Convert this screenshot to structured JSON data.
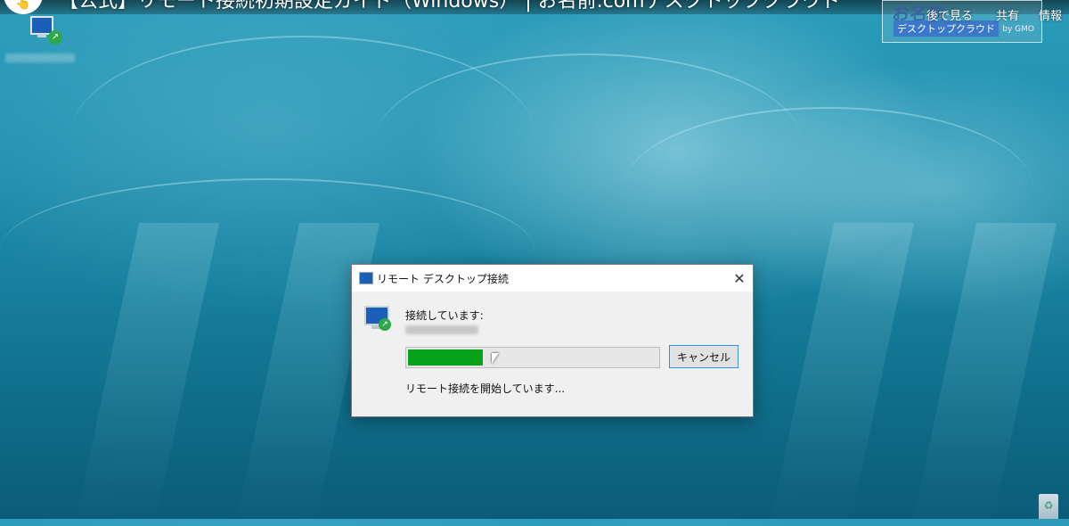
{
  "video": {
    "title": "【公式】リモート接続初期設定ガイド（Windows） | お名前.comデスクトップクラウド",
    "watch_later": "後で見る",
    "share": "共有",
    "info": "情報"
  },
  "brand": {
    "logo_top": "お名前",
    "logo_bottom": "デスクトップクラウド",
    "logo_by": "by GMO"
  },
  "desktop": {
    "icons": [
      {
        "name": "remote-desktop-connection",
        "icon": "monitor-icon"
      }
    ]
  },
  "dialog": {
    "title": "リモート デスクトップ接続",
    "connecting_label": "接続しています:",
    "progress_percent": 30,
    "cancel_label": "キャンセル",
    "status": "リモート接続を開始しています..."
  },
  "colors": {
    "progress_fill": "#06a21a",
    "button_focus_border": "#3c8bd8",
    "dialog_bg": "#f0f0f0"
  }
}
